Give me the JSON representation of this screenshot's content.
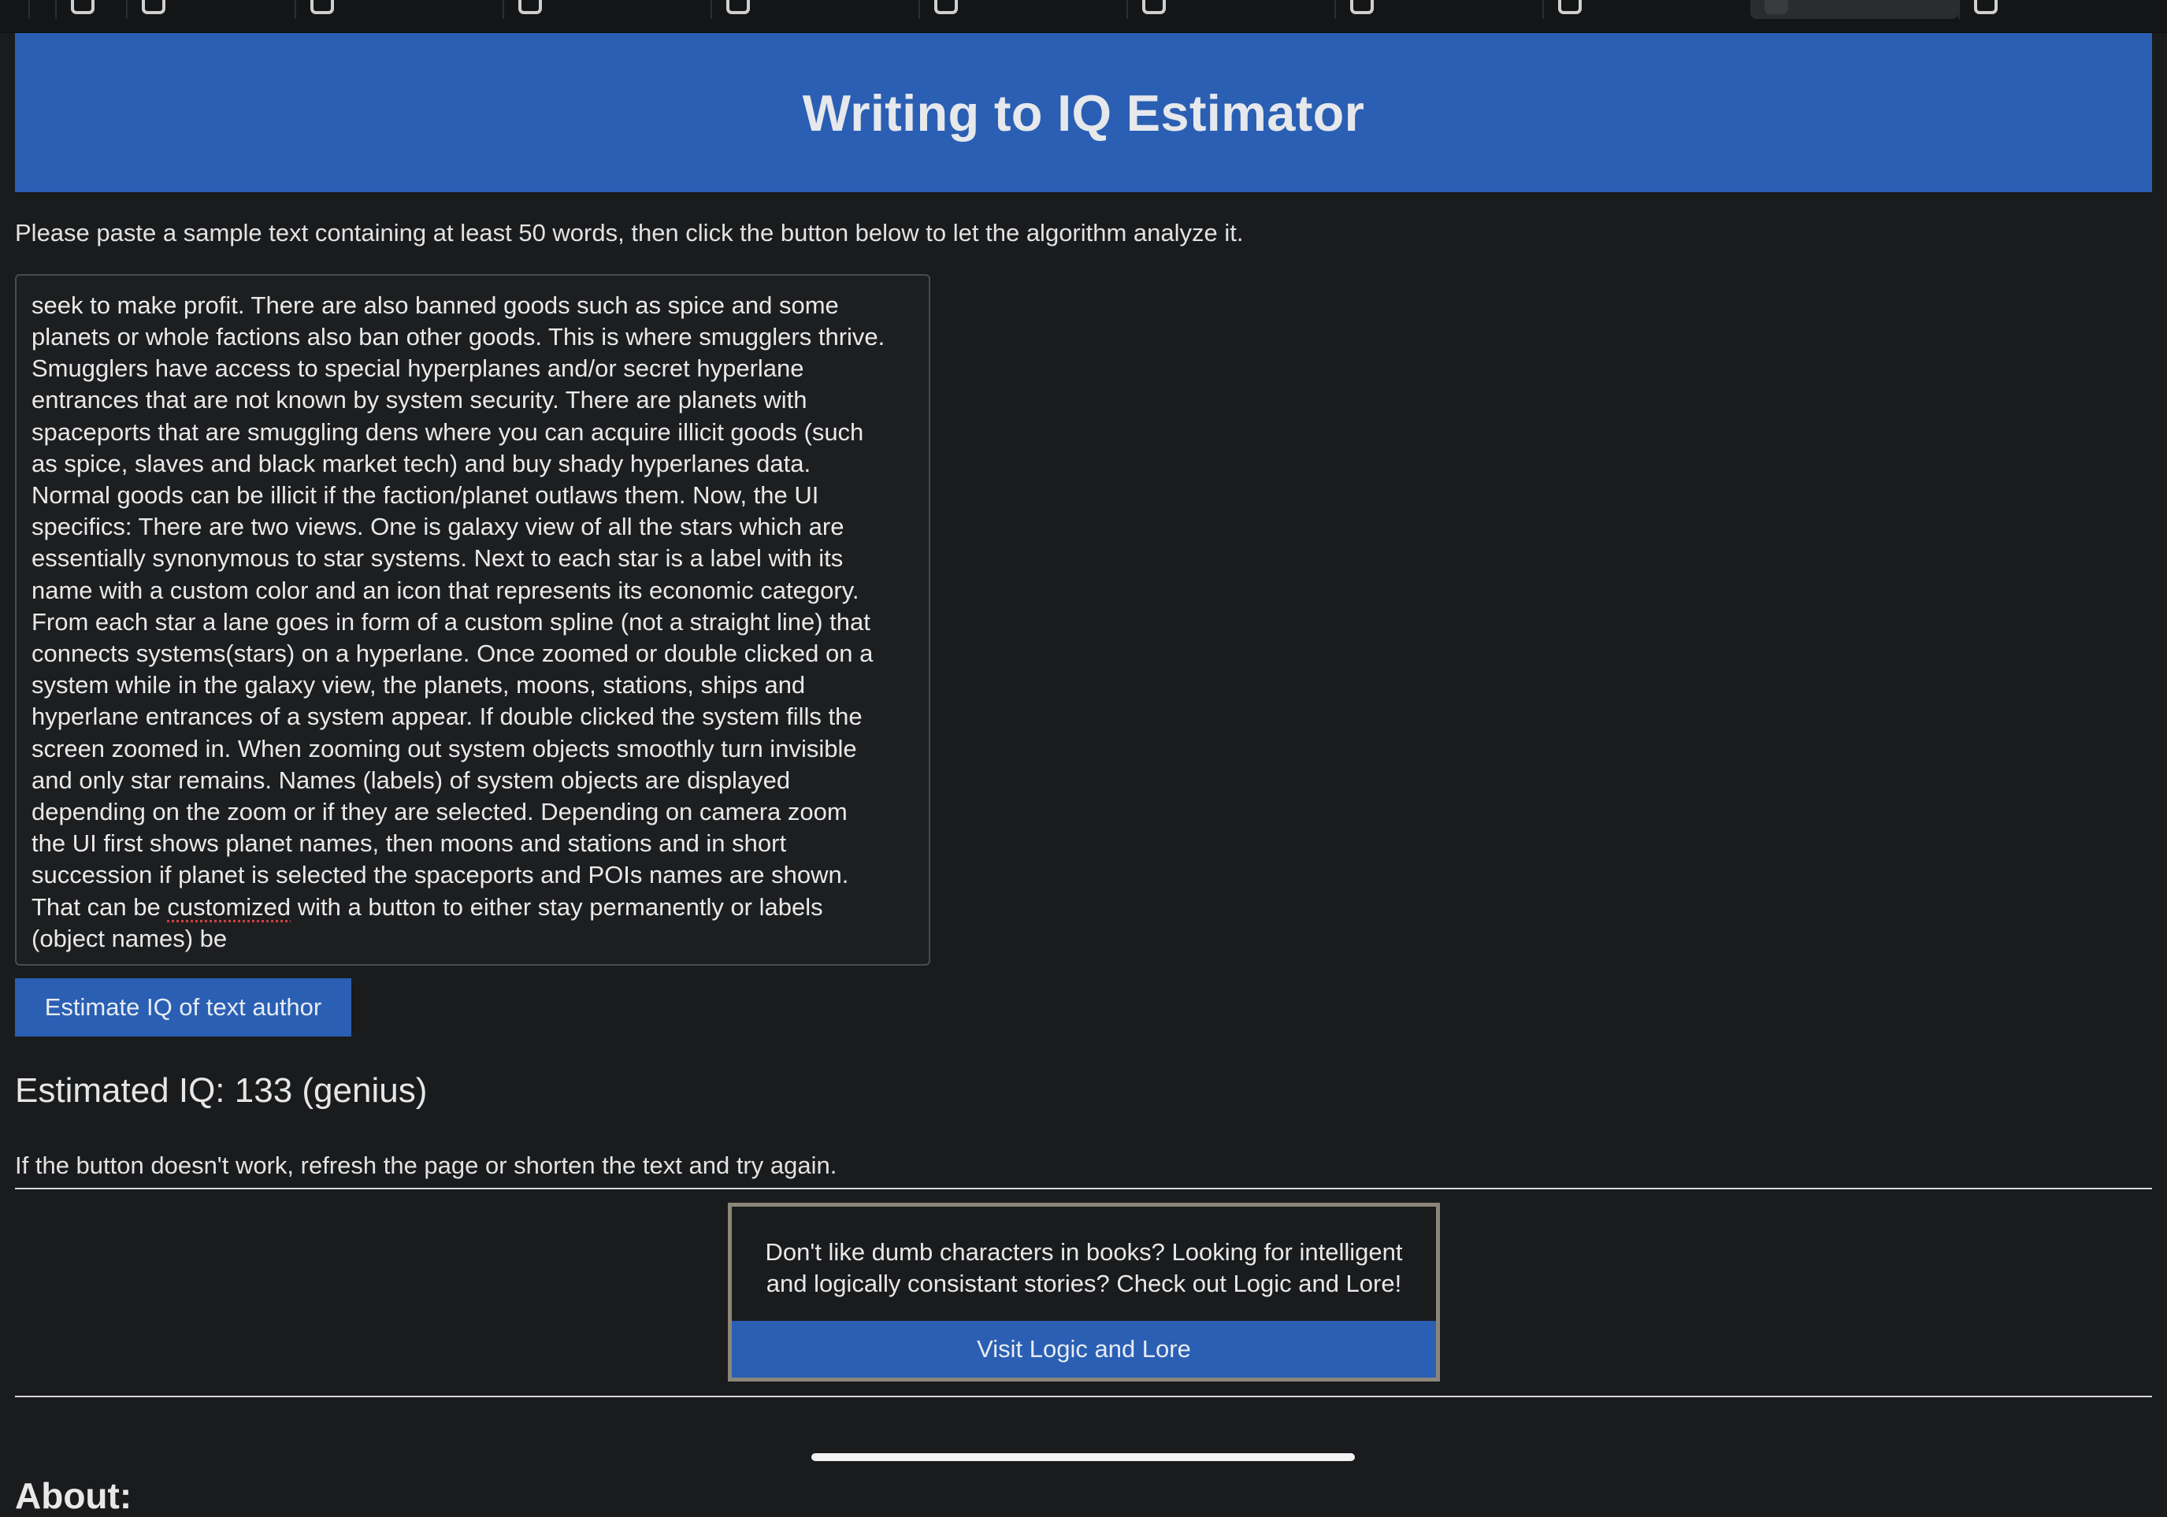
{
  "header": {
    "title": "Writing to IQ Estimator"
  },
  "intro": "Please paste a sample text containing at least 50 words, then click the button below to let the algorithm analyze it.",
  "sample": {
    "lines": [
      "seek to make profit. There are also banned goods such as spice and some",
      "planets or whole factions also ban other goods. This is where smugglers thrive.",
      "Smugglers have access to special hyperplanes and/or secret hyperlane",
      "entrances that are not known by system security. There are planets with",
      "spaceports that are smuggling dens where you can acquire illicit goods (such",
      "as spice, slaves and black market tech) and buy shady hyperlanes data.",
      "Normal goods can be illicit if the faction/planet outlaws them. Now, the UI",
      "specifics: There are two views. One is galaxy view of all the stars which are",
      "essentially synonymous to star systems. Next to each star is a label with its",
      "name with a custom color and an icon that represents its economic category.",
      "From each star a lane goes in form of a custom spline (not a straight line) that",
      "connects systems(stars) on a hyperlane. Once zoomed or double clicked on a",
      "system while in the galaxy view, the planets, moons, stations, ships and",
      "hyperlane entrances of a system appear. If double clicked the system fills the",
      "screen zoomed in. When zooming out system objects smoothly turn invisible",
      "and only star remains. Names (labels) of system objects are displayed",
      "depending on the zoom or if they are selected. Depending on camera zoom",
      "the UI first shows planet names, then moons and stations and in short",
      "succession if planet is selected the spaceports and POIs names are shown."
    ],
    "line_last_a": "That can be ",
    "line_last_misspelled": "customized",
    "line_last_b": " with a button to either stay permanently or labels",
    "line_final": "(object names) be"
  },
  "estimate_button": "Estimate IQ of text author",
  "result": "Estimated IQ: 133 (genius)",
  "note": "If the button doesn't work, refresh the page or shorten the text and try again.",
  "promo": {
    "text_line1": "Don't like dumb characters in books? Looking for intelligent",
    "text_line2": "and logically consistant stories? Check out Logic and Lore!",
    "button": "Visit Logic and Lore"
  },
  "about_heading": "About:",
  "colors": {
    "accent": "#2a5fb4",
    "background": "#1a1b1d",
    "promo_border": "#8b8679"
  }
}
